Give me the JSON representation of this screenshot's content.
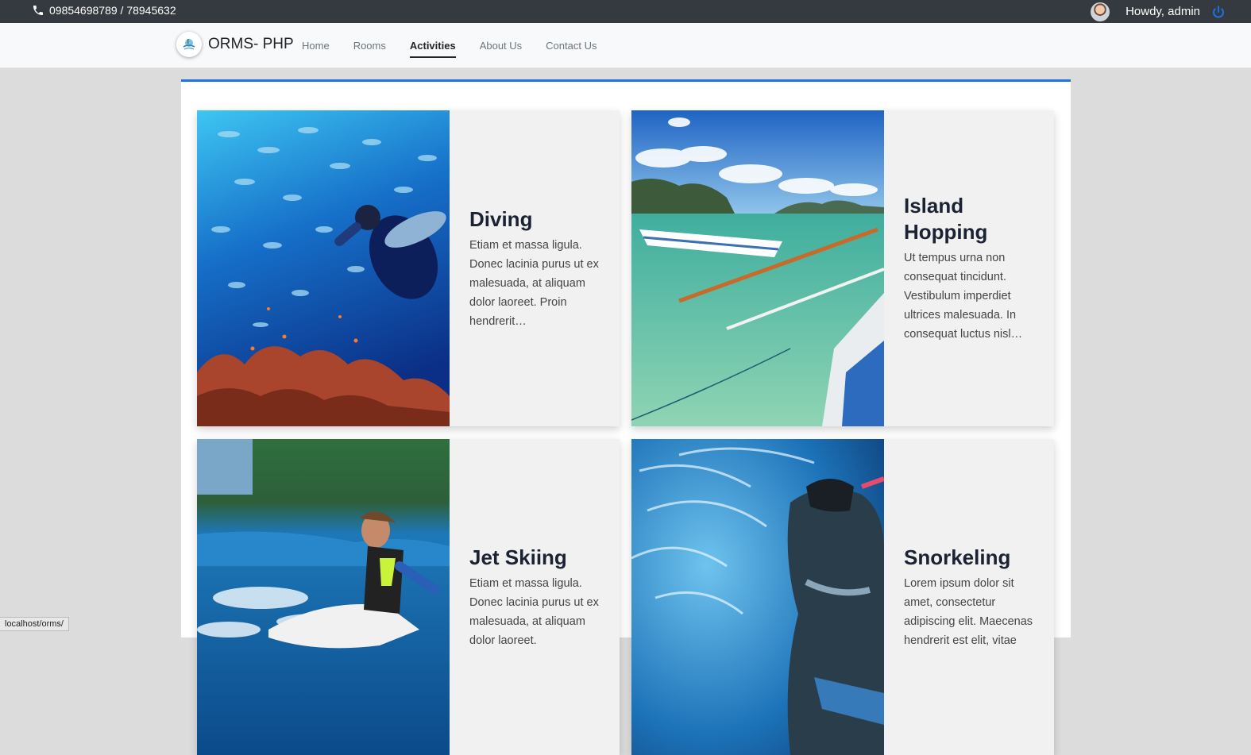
{
  "topbar": {
    "phone": "09854698789 / 78945632",
    "greeting": "Howdy, admin",
    "phone_icon": "phone-icon",
    "power_icon": "power-icon"
  },
  "navbar": {
    "brand": "ORMS- PHP",
    "items": [
      {
        "label": "Home",
        "active": false
      },
      {
        "label": "Rooms",
        "active": false
      },
      {
        "label": "Activities",
        "active": true
      },
      {
        "label": "About Us",
        "active": false
      },
      {
        "label": "Contact Us",
        "active": false
      }
    ]
  },
  "activities": [
    {
      "title": "Diving",
      "description": "Etiam et massa ligula. Donec lacinia purus ut ex malesuada, at aliquam dolor laoreet. Proin hendrerit…"
    },
    {
      "title": "Island Hopping",
      "description": "Ut tempus urna non consequat tincidunt. Vestibulum imperdiet ultrices malesuada. In consequat luctus nisl…"
    },
    {
      "title": "Jet Skiing",
      "description": "Etiam et massa ligula. Donec lacinia purus ut ex malesuada, at aliquam dolor laoreet."
    },
    {
      "title": "Snorkeling",
      "description": "Lorem ipsum dolor sit amet, consectetur adipiscing elit. Maecenas hendrerit est elit, vitae"
    }
  ],
  "status_url": "localhost/orms/",
  "colors": {
    "accent": "#1a73e8",
    "topbar": "#343a40"
  }
}
